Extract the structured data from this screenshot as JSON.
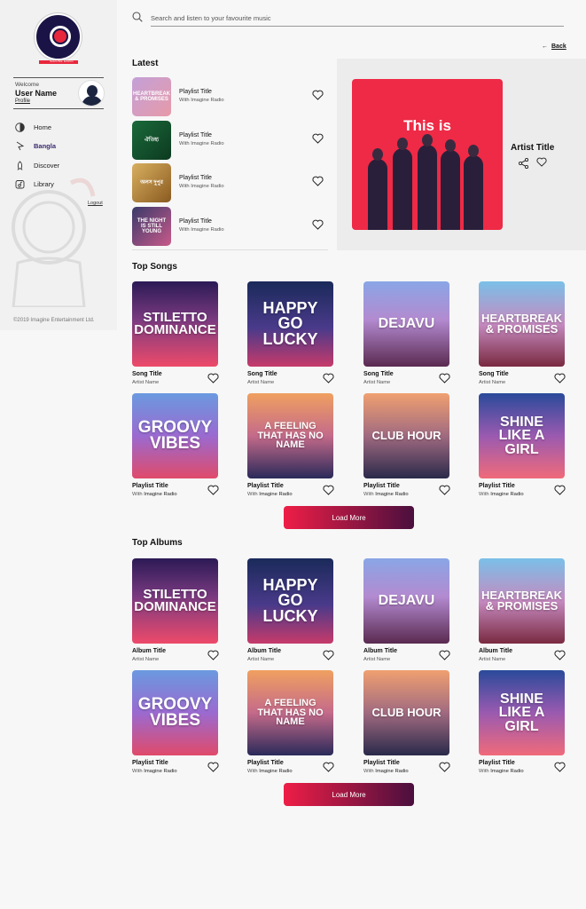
{
  "brand": {
    "logo_text": "IMAGINE RADIO",
    "accent": "#e8273c"
  },
  "sidebar": {
    "welcome": "Welcome",
    "username": "User Name",
    "profile_link": "Profile",
    "items": [
      {
        "label": "Home",
        "icon": "home-icon",
        "active": false
      },
      {
        "label": "Bangla",
        "icon": "bangla-icon",
        "active": true
      },
      {
        "label": "Discover",
        "icon": "discover-icon",
        "active": false
      },
      {
        "label": "Library",
        "icon": "library-icon",
        "active": false
      }
    ],
    "logout": "Logout",
    "copyright": "©2019 Imagine Entertainment Ltd."
  },
  "search": {
    "placeholder": "Search and listen to your favourite music"
  },
  "back": {
    "label": "Back"
  },
  "latest": {
    "title": "Latest",
    "items": [
      {
        "art_text": "Heartbreak & Promises",
        "title": "Playlist Title",
        "subtitle": "With Imagine Radio"
      },
      {
        "art_text": "ঐতিহ্য",
        "title": "Playlist Title",
        "subtitle": "With Imagine Radio"
      },
      {
        "art_text": "অলস দুপুর",
        "title": "Playlist Title",
        "subtitle": "With Imagine Radio"
      },
      {
        "art_text": "The Night Is Still Young",
        "title": "Playlist Title",
        "subtitle": "With Imagine Radio"
      }
    ]
  },
  "feature": {
    "art_text": "This is",
    "artist_title": "Artist Title"
  },
  "top_songs": {
    "title": "Top Songs",
    "cards": [
      {
        "art_text": "Stiletto Dominance",
        "title": "Song Title",
        "subtitle": "Artist Name"
      },
      {
        "art_text": "Happy Go Lucky",
        "title": "Song Title",
        "subtitle": "Artist Name"
      },
      {
        "art_text": "Dejavu",
        "title": "Song Title",
        "subtitle": "Artist Name"
      },
      {
        "art_text": "Heartbreak & Promises",
        "title": "Song Title",
        "subtitle": "Artist Name"
      },
      {
        "art_text": "Groovy Vibes",
        "title": "Playlist Title",
        "subtitle_prefix": "With",
        "subtitle_strong": "Imagine Radio"
      },
      {
        "art_text": "A Feeling That Has No Name",
        "title": "Playlist Title",
        "subtitle_prefix": "With",
        "subtitle_strong": "Imagine Radio"
      },
      {
        "art_text": "Club Hour",
        "title": "Playlist Title",
        "subtitle_prefix": "With",
        "subtitle_strong": "Imagine Radio"
      },
      {
        "art_text": "Shine Like A Girl",
        "title": "Playlist Title",
        "subtitle_prefix": "With",
        "subtitle_strong": "Imagine Radio"
      }
    ],
    "load_more": "Load More"
  },
  "top_albums": {
    "title": "Top Albums",
    "cards": [
      {
        "art_text": "Stiletto Dominance",
        "title": "Album Title",
        "subtitle": "Artist Name"
      },
      {
        "art_text": "Happy Go Lucky",
        "title": "Album Title",
        "subtitle": "Artist Name"
      },
      {
        "art_text": "Dejavu",
        "title": "Album Title",
        "subtitle": "Artist Name"
      },
      {
        "art_text": "Heartbreak & Promises",
        "title": "Album Title",
        "subtitle": "Artist Name"
      },
      {
        "art_text": "Groovy Vibes",
        "title": "Playlist Title",
        "subtitle_prefix": "With",
        "subtitle_strong": "Imagine Radio"
      },
      {
        "art_text": "A Feeling That Has No Name",
        "title": "Playlist Title",
        "subtitle_prefix": "With",
        "subtitle_strong": "Imagine Radio"
      },
      {
        "art_text": "Club Hour",
        "title": "Playlist Title",
        "subtitle_prefix": "With",
        "subtitle_strong": "Imagine Radio"
      },
      {
        "art_text": "Shine Like A Girl",
        "title": "Playlist Title",
        "subtitle_prefix": "With",
        "subtitle_strong": "Imagine Radio"
      }
    ],
    "load_more": "Load More"
  }
}
